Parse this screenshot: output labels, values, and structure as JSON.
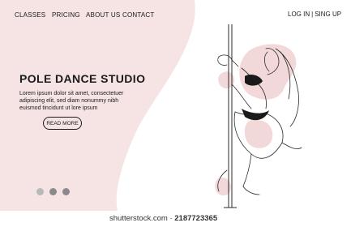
{
  "colors": {
    "background": "#ffffff",
    "pink_shape": "#f6e4e5",
    "figure_blob": "#f2d8d9",
    "text": "#1a1a1a"
  },
  "nav": {
    "items": [
      {
        "label": "CLASSES"
      },
      {
        "label": "PRICING"
      },
      {
        "label": "ABOUT US"
      },
      {
        "label": "CONTACT"
      }
    ]
  },
  "auth": {
    "login": "LOG IN",
    "separator": "|",
    "signup": "SING UP"
  },
  "hero": {
    "title": "POLE DANCE STUDIO",
    "body": "Lorem ipsum dolor sit amet, consectetuer adipiscing elit, sed diam nonummy nibh euismod tincidunt ut lore ipsum",
    "button_label": "READ MORE"
  },
  "carousel": {
    "dots": 3,
    "active_index": 0
  },
  "watermark": {
    "site": "shutterstock.com",
    "separator": "·",
    "image_id": "2187723365"
  }
}
